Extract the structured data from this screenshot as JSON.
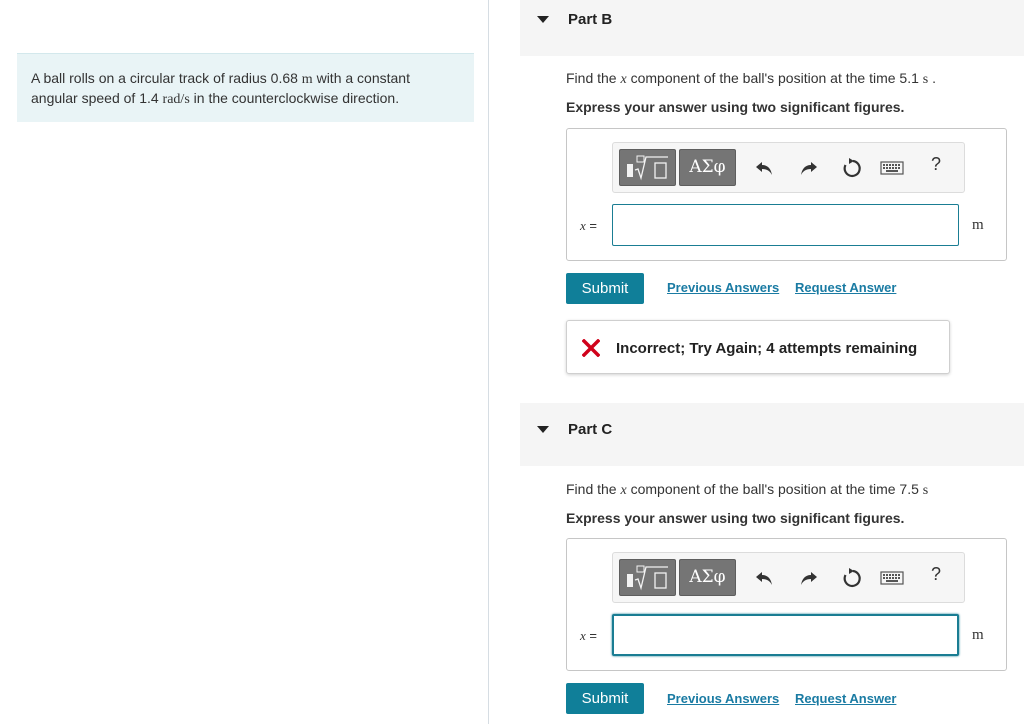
{
  "problem": {
    "text_1": "A ball rolls on a circular track of radius 0.68 ",
    "unit_radius": "m",
    "text_2": " with a constant",
    "text_3": "angular speed of 1.4 ",
    "unit_speed": "rad/s",
    "text_4": " in the counterclockwise direction."
  },
  "toolbar": {
    "template_icon": "sqrt-template-icon",
    "greek_label": "ΑΣφ",
    "undo_icon": "undo-icon",
    "redo_icon": "redo-icon",
    "reset_icon": "reset-icon",
    "keyboard_icon": "keyboard-icon",
    "help_label": "?"
  },
  "part_b": {
    "title": "Part B",
    "prompt_1": "Find the ",
    "prompt_var": "x",
    "prompt_2": " component of the ball's position at the time 5.1 ",
    "prompt_unit": "s",
    "prompt_3": " .",
    "instruction": "Express your answer using two significant figures.",
    "var_label_var": "x",
    "var_label_eq": " =",
    "input_value": "",
    "unit": "m",
    "submit_label": "Submit",
    "prev_answers_label": "Previous Answers",
    "request_answer_label": "Request Answer",
    "feedback": "Incorrect; Try Again; 4 attempts remaining"
  },
  "part_c": {
    "title": "Part C",
    "prompt_1": "Find the ",
    "prompt_var": "x",
    "prompt_2": " component of the ball's position at the time 7.5 ",
    "prompt_unit": "s",
    "instruction": "Express your answer using two significant figures.",
    "var_label_var": "x",
    "var_label_eq": " =",
    "input_value": "",
    "unit": "m",
    "submit_label": "Submit",
    "prev_answers_label": "Previous Answers",
    "request_answer_label": "Request Answer"
  },
  "colors": {
    "accent": "#107f99",
    "link": "#1a7ba3",
    "error": "#d0021b",
    "problem_bg": "#e9f4f6"
  }
}
